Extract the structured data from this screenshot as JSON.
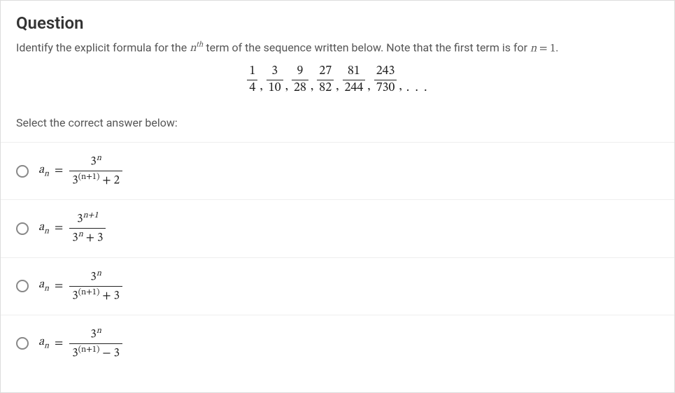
{
  "title": "Question",
  "prompt_pre": "Identify the explicit formula for the ",
  "prompt_nth_base": "n",
  "prompt_nth_sup": "th",
  "prompt_mid": " term of the sequence written below. Note that the first term is for ",
  "prompt_eq_lhs": "n",
  "prompt_eq_op": " = ",
  "prompt_eq_rhs": "1",
  "prompt_end": ".",
  "sequence": [
    {
      "num": "1",
      "den": "4"
    },
    {
      "num": "3",
      "den": "10"
    },
    {
      "num": "9",
      "den": "28"
    },
    {
      "num": "27",
      "den": "82"
    },
    {
      "num": "81",
      "den": "244"
    },
    {
      "num": "243",
      "den": "730"
    }
  ],
  "comma": ",",
  "ellipsis": "…",
  "select_label": "Select the correct answer below:",
  "lhs_var": "a",
  "lhs_sub": "n",
  "equals": "=",
  "options": [
    {
      "num_base": "3",
      "num_exp": "n",
      "den_base": "3",
      "den_exp": "(n+1)",
      "den_op": " + ",
      "den_const": "2"
    },
    {
      "num_base": "3",
      "num_exp": "n+1",
      "den_base": "3",
      "den_exp": "n",
      "den_op": " + ",
      "den_const": "3"
    },
    {
      "num_base": "3",
      "num_exp": "n",
      "den_base": "3",
      "den_exp": "(n+1)",
      "den_op": " + ",
      "den_const": "3"
    },
    {
      "num_base": "3",
      "num_exp": "n",
      "den_base": "3",
      "den_exp": "(n+1)",
      "den_op": " − ",
      "den_const": "3"
    }
  ]
}
